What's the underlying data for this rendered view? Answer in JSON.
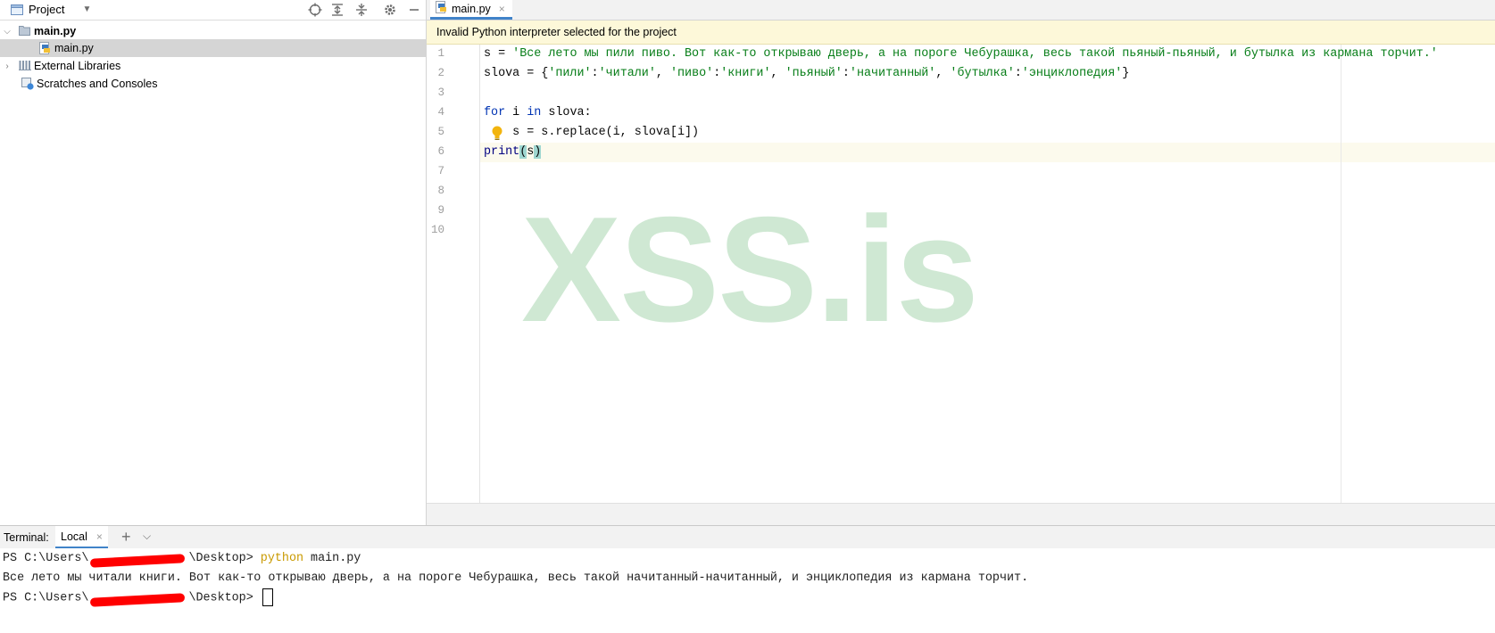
{
  "project_panel": {
    "title": "Project",
    "tree": [
      {
        "label": "main.py",
        "bold": true
      },
      {
        "label": "main.py",
        "selected": true
      },
      {
        "label": "External Libraries"
      },
      {
        "label": "Scratches and Consoles"
      }
    ]
  },
  "editor": {
    "tab_label": "main.py",
    "tab_close": "×",
    "banner": "Invalid Python interpreter selected for the project",
    "line_numbers": [
      "1",
      "2",
      "3",
      "4",
      "5",
      "6",
      "7",
      "8",
      "9",
      "10"
    ],
    "code": {
      "l1_var": "s = ",
      "l1_str": "'Все лето мы пили пиво. Вот как-то открываю дверь, а на пороге Чебурашка, весь такой пьяный-пьяный, и бутылка из кармана торчит.'",
      "l2_a": "slova = {",
      "l2_k1": "'пили'",
      "l2_v1": "'читали'",
      "l2_k2": "'пиво'",
      "l2_v2": "'книги'",
      "l2_k3": "'пьяный'",
      "l2_v3": "'начитанный'",
      "l2_k4": "'бутылка'",
      "l2_v4": "'энциклопедия'",
      "l2_colon": ":",
      "l2_comma": ", ",
      "l2_end": "}",
      "l4_for": "for",
      "l4_i": " i ",
      "l4_in": "in",
      "l4_rest": " slova:",
      "l5": "    s = s.replace(i, slova[i])",
      "l6_print": "print",
      "l6_open": "(",
      "l6_arg": "s",
      "l6_close": ")"
    },
    "watermark": "XSS.is"
  },
  "terminal": {
    "label": "Terminal:",
    "tab": "Local",
    "tab_close": "×",
    "add": "+",
    "line1_prompt_a": "PS C:\\Users\\",
    "line1_prompt_b": "\\Desktop> ",
    "line1_cmd": "python",
    "line1_arg": " main.py",
    "line2": "Все лето мы читали книги. Вот как-то открываю дверь, а на пороге Чебурашка, весь такой начитанный-начитанный, и энциклопедия из кармана торчит.",
    "line3_prompt_a": "PS C:\\Users\\",
    "line3_prompt_b": "\\Desktop> "
  },
  "colors": {
    "keyword": "#0033b3",
    "string": "#067d17",
    "banner_bg": "#fdf8d9",
    "tab_accent": "#4083c9",
    "watermark": "#cfe8d3"
  }
}
